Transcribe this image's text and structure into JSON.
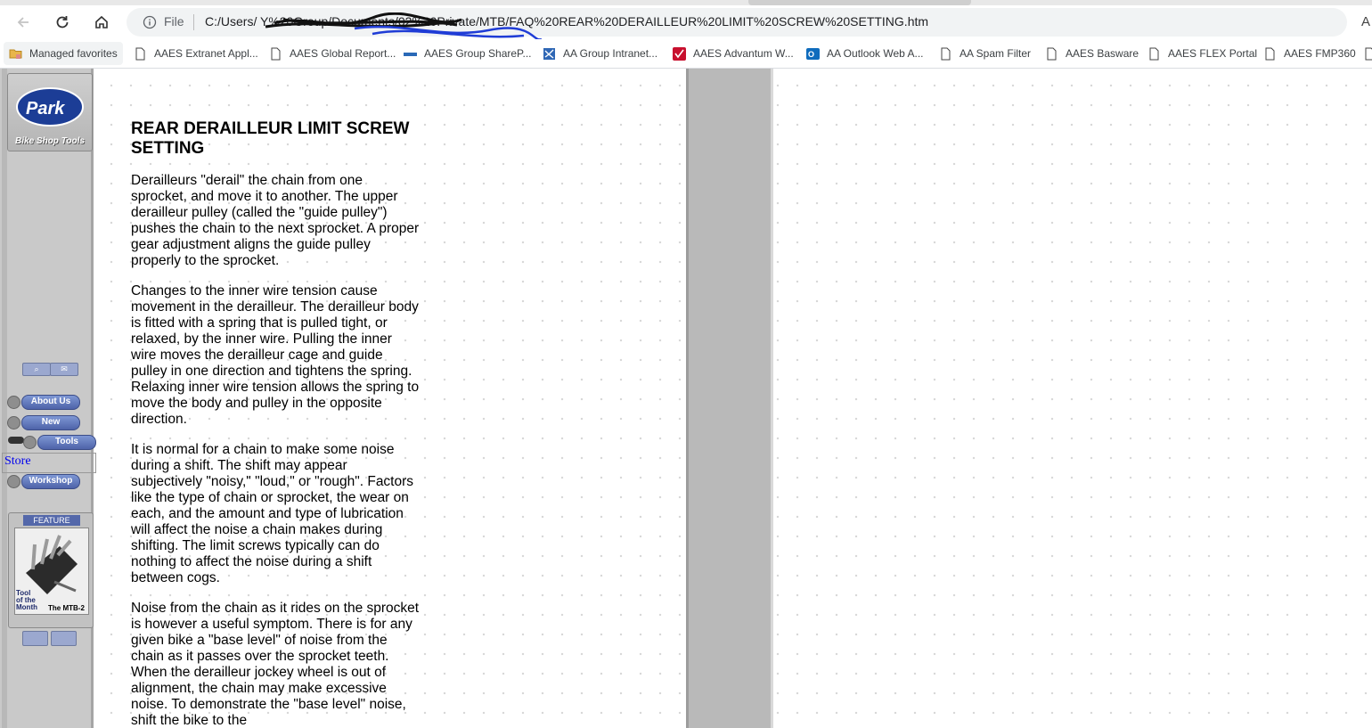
{
  "browser": {
    "file_label": "File",
    "url": "C:/Users/                                                  Y%20Group/Documents/02%20Private/MTB/FAQ%20REAR%20DERAILLEUR%20LIMIT%20SCREW%20SETTING.htm",
    "read_mode_glyph": "A",
    "bookmarks": [
      {
        "label": "Managed favorites",
        "icon": "folder-icon"
      },
      {
        "label": "AAES Extranet Appl...",
        "icon": "page-icon"
      },
      {
        "label": "AAES Global Report...",
        "icon": "page-icon"
      },
      {
        "label": "AAES Group ShareP...",
        "icon": "sharepoint-icon"
      },
      {
        "label": "AA Group Intranet...",
        "icon": "intranet-icon"
      },
      {
        "label": "AAES Advantum W...",
        "icon": "check-icon"
      },
      {
        "label": "AA Outlook Web A...",
        "icon": "outlook-icon"
      },
      {
        "label": "AA Spam Filter",
        "icon": "page-icon"
      },
      {
        "label": "AAES Basware",
        "icon": "page-icon"
      },
      {
        "label": "AAES FLEX Portal",
        "icon": "page-icon"
      },
      {
        "label": "AAES FMP360",
        "icon": "page-icon"
      }
    ]
  },
  "sidebar": {
    "logo_text": "Park",
    "logo_tagline": "Bike Shop Tools",
    "nav": [
      {
        "label": "About Us"
      },
      {
        "label": "New"
      },
      {
        "label": "Tools"
      },
      {
        "label": "Workshop"
      }
    ],
    "store_link": "Store",
    "feature": {
      "title": "FEATURE",
      "caption_1": "Tool",
      "caption_2": "of the",
      "caption_3": "Month",
      "product": "The MTB-2"
    }
  },
  "article": {
    "title": "REAR DERAILLEUR LIMIT SCREW SETTING",
    "paragraphs": [
      "Derailleurs \"derail\" the chain from one sprocket, and move it to another. The upper derailleur pulley (called the \"guide pulley\") pushes the chain to the next sprocket. A proper gear adjustment aligns the guide pulley properly to the sprocket.",
      "Changes to the inner wire tension cause movement in the derailleur. The derailleur body is fitted with a spring that is pulled tight, or relaxed, by the inner wire. Pulling the inner wire moves the derailleur cage and guide pulley in one direction and tightens the spring. Relaxing inner wire tension allows the spring to move the body and pulley in the opposite direction.",
      "It is normal for a chain to make some noise during a shift. The shift may appear subjectively \"noisy,\" \"loud,\" or \"rough\". Factors like the type of chain or sprocket, the wear on each, and the amount and type of lubrication will affect the noise a chain makes during shifting. The limit screws typically can do nothing to affect the noise during a shift between cogs.",
      "Noise from the chain as it rides on the sprocket is however a useful symptom. There is for any given bike a \"base level\" of noise from the chain as it passes over the sprocket teeth. When the derailleur jockey wheel is out of alignment, the chain may make excessive noise. To demonstrate the \"base level\" noise, shift the bike to the"
    ]
  }
}
